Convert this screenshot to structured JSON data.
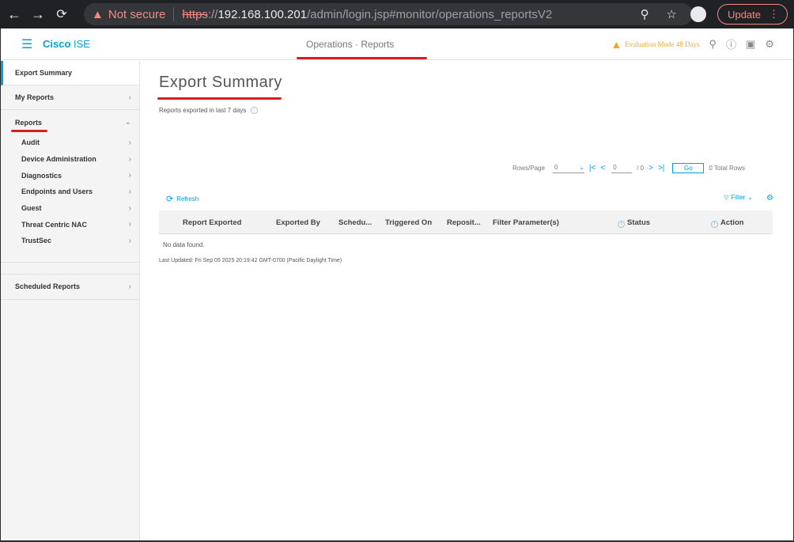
{
  "browser": {
    "not_secure": "Not secure",
    "url_scheme": "https",
    "url_sep": "://",
    "url_host": "192.168.100.201",
    "url_path": "/admin/login.jsp#monitor/operations_reportsV2",
    "update_label": "Update"
  },
  "header": {
    "brand_cisco": "Cisco",
    "brand_product": " ISE",
    "title": "Operations · Reports",
    "evaluation": "Evaluation Mode 48 Days"
  },
  "sidebar": {
    "export_summary": "Export Summary",
    "my_reports": "My Reports",
    "reports": "Reports",
    "report_items": [
      "Audit",
      "Device Administration",
      "Diagnostics",
      "Endpoints and Users",
      "Guest",
      "Threat Centric NAC",
      "TrustSec"
    ],
    "scheduled_reports": "Scheduled Reports"
  },
  "main": {
    "title": "Export Summary",
    "subtitle": "Reports exported in last 7 days",
    "pager": {
      "rows_label": "Rows/Page",
      "rows_value": "0",
      "page_value": "0",
      "of_label": "/ 0",
      "go_label": "Go",
      "total_label": "0 Total Rows"
    },
    "refresh_label": "Refresh",
    "filter_label": "Filter",
    "columns": [
      "Report Exported",
      "Exported By",
      "Schedu...",
      "Triggered On",
      "Reposit...",
      "Filter Parameter(s)",
      "Status",
      "Action"
    ],
    "no_data": "No data found.",
    "last_updated": "Last Updated: Fri Sep 05 2025 20:19:42 GMT-0700 (Pacific Daylight Time)"
  },
  "colors": {
    "accent": "#049fd9",
    "annotation_red": "#d32020",
    "warning": "#f5a623"
  },
  "icons": [
    "back-arrow-icon",
    "forward-arrow-icon",
    "reload-icon",
    "warning-icon",
    "zoom-icon",
    "star-icon",
    "hamburger-icon",
    "help-icon",
    "search-icon",
    "settings-icon",
    "refresh-icon",
    "filter-icon",
    "info-icon",
    "chevron-right-icon",
    "chevron-down-icon"
  ]
}
